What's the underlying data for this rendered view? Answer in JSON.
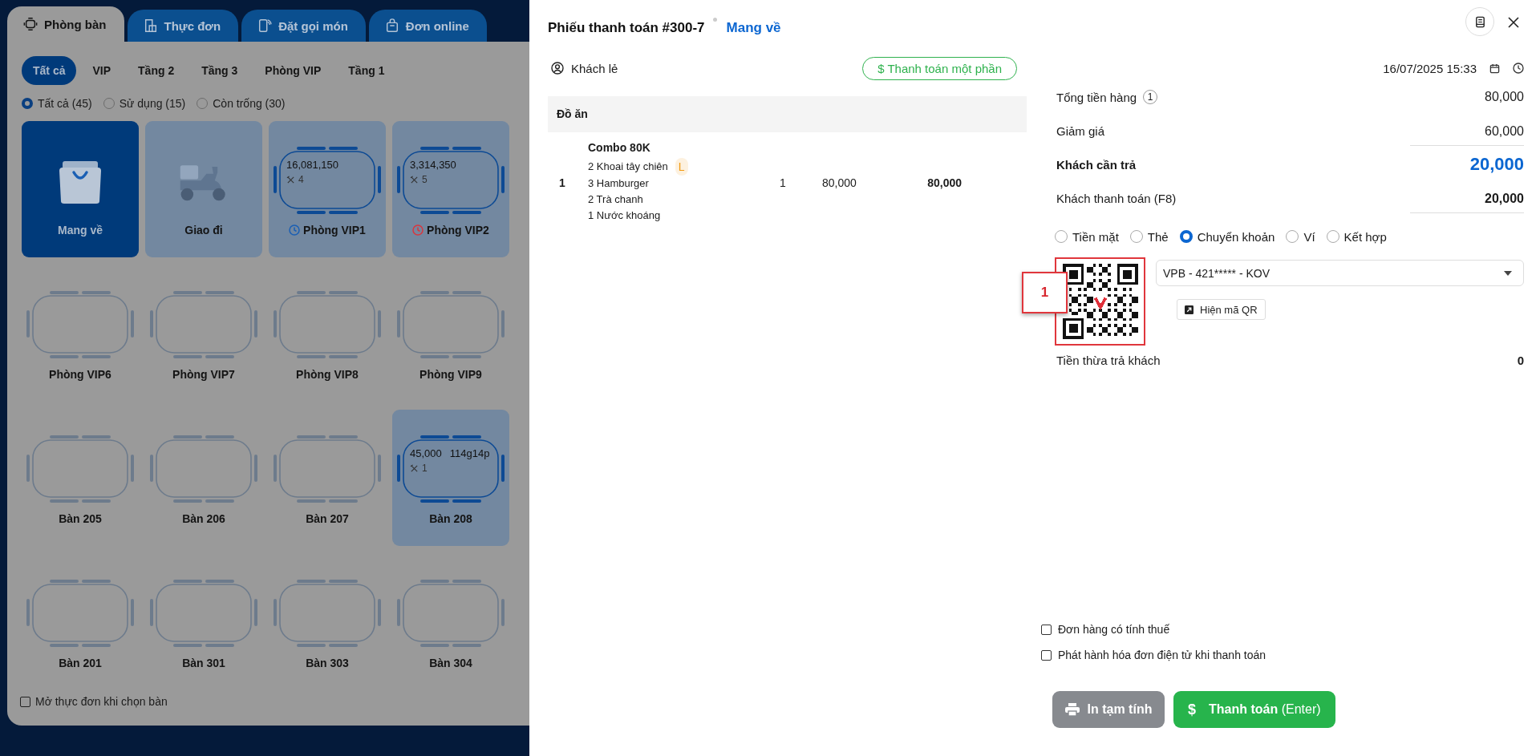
{
  "top_tabs": [
    {
      "label": "Phòng bàn",
      "selected": true
    },
    {
      "label": "Thực đơn",
      "selected": false
    },
    {
      "label": "Đặt gọi món",
      "selected": false
    },
    {
      "label": "Đơn online",
      "selected": false
    }
  ],
  "area_filters": [
    {
      "label": "Tất cả",
      "selected": true
    },
    {
      "label": "VIP",
      "selected": false
    },
    {
      "label": "Tầng 2",
      "selected": false
    },
    {
      "label": "Tầng 3",
      "selected": false
    },
    {
      "label": "Phòng VIP",
      "selected": false
    },
    {
      "label": "Tầng 1",
      "selected": false
    }
  ],
  "status_filters": [
    {
      "label": "Tất cả (45)",
      "selected": true
    },
    {
      "label": "Sử dụng (15)",
      "selected": false
    },
    {
      "label": "Còn trống (30)",
      "selected": false
    }
  ],
  "tables": [
    {
      "name": "Mang về",
      "kind": "takeaway",
      "selected": true
    },
    {
      "name": "Giao đi",
      "kind": "delivery",
      "selected": false
    },
    {
      "name": "Phòng VIP1",
      "kind": "table",
      "occupied": true,
      "selected": false,
      "amount": "16,081,150",
      "guests": "4",
      "color": "#1a5fb4"
    },
    {
      "name": "Phòng VIP2",
      "kind": "table",
      "occupied": true,
      "selected": false,
      "amount": "3,314,350",
      "guests": "5",
      "color": "#d9363e"
    },
    {
      "name": "Phòng VIP6",
      "kind": "table",
      "occupied": false,
      "selected": false
    },
    {
      "name": "Phòng VIP7",
      "kind": "table",
      "occupied": false,
      "selected": false
    },
    {
      "name": "Phòng VIP8",
      "kind": "table",
      "occupied": false,
      "selected": false
    },
    {
      "name": "Phòng VIP9",
      "kind": "table",
      "occupied": false,
      "selected": false
    },
    {
      "name": "Bàn 205",
      "kind": "table",
      "occupied": false,
      "selected": false
    },
    {
      "name": "Bàn 206",
      "kind": "table",
      "occupied": false,
      "selected": false
    },
    {
      "name": "Bàn 207",
      "kind": "table",
      "occupied": false,
      "selected": false
    },
    {
      "name": "Bàn 208",
      "kind": "table",
      "occupied": true,
      "selected": false,
      "amount": "45,000",
      "elapsed": "114g14p",
      "guests": "1"
    },
    {
      "name": "Bàn 201",
      "kind": "table",
      "occupied": false,
      "selected": false
    },
    {
      "name": "Bàn 301",
      "kind": "table",
      "occupied": false,
      "selected": false
    },
    {
      "name": "Bàn 303",
      "kind": "table",
      "occupied": false,
      "selected": false
    },
    {
      "name": "Bàn 304",
      "kind": "table",
      "occupied": false,
      "selected": false
    }
  ],
  "open_menu_option": {
    "label": "Mở thực đơn khi chọn bàn",
    "checked": false
  },
  "payment": {
    "title": "Phiếu thanh toán #300-7",
    "order_type": "Mang về",
    "customer": "Khách lẻ",
    "partial_button": "$ Thanh toán một phần",
    "datetime": "16/07/2025 15:33",
    "section": "Đồ ăn",
    "items": [
      {
        "index": "1",
        "name": "Combo 80K",
        "components": [
          {
            "text": "2 Khoai tây chiên",
            "badge": "L"
          },
          {
            "text": "3 Hamburger"
          },
          {
            "text": "2 Trà chanh"
          },
          {
            "text": "1 Nước khoáng"
          }
        ],
        "quantity": "1",
        "price": "80,000",
        "total": "80,000"
      }
    ],
    "summary": [
      {
        "label": "Tổng tiền hàng",
        "count": "1",
        "value": "80,000",
        "kind": "plain"
      },
      {
        "label": "Giảm giá",
        "value": "60,000",
        "kind": "input"
      },
      {
        "label": "Khách cần trả",
        "value": "20,000",
        "kind": "due"
      },
      {
        "label": "Khách thanh toán (F8)",
        "value": "20,000",
        "kind": "paid"
      }
    ],
    "payment_methods": [
      {
        "label": "Tiền mặt",
        "selected": false
      },
      {
        "label": "Thẻ",
        "selected": false
      },
      {
        "label": "Chuyển khoản",
        "selected": true
      },
      {
        "label": "Ví",
        "selected": false
      },
      {
        "label": "Kết hợp",
        "selected": false
      }
    ],
    "bank_account": "VPB - 421***** - KOV",
    "show_qr_button": "Hiện mã QR",
    "callout": "1",
    "change": {
      "label": "Tiền thừa trả khách",
      "value": "0"
    },
    "options": [
      {
        "label": "Đơn hàng có tính thuế",
        "checked": false
      },
      {
        "label": "Phát hành hóa đơn điện tử khi thanh toán",
        "checked": false
      }
    ],
    "print_button": "In tạm tính",
    "pay_button": {
      "icon": "$",
      "label": "**Thanh toán** (Enter)"
    }
  }
}
